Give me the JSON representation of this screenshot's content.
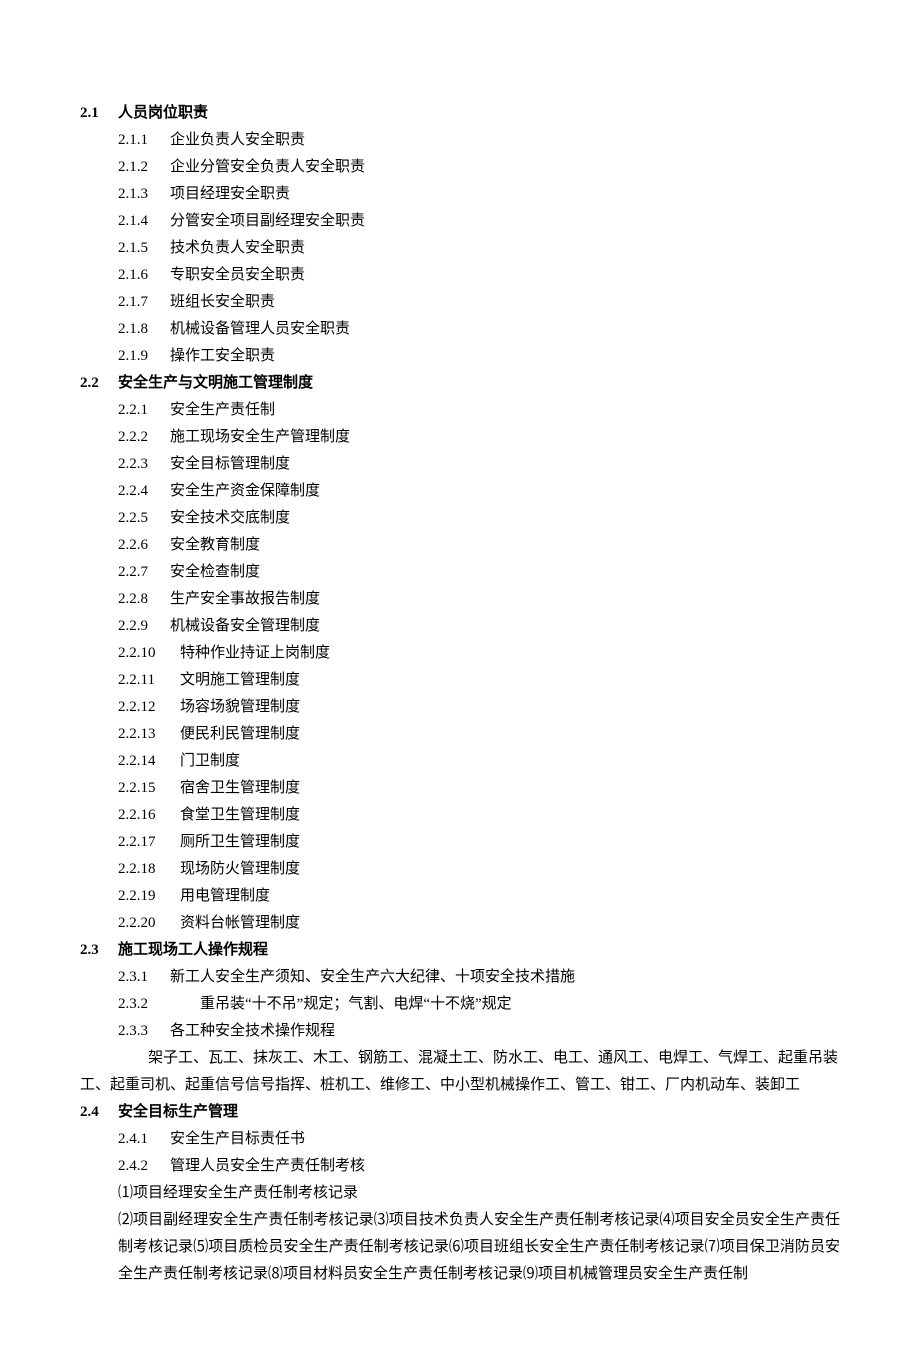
{
  "sections": {
    "s2_1": {
      "number": "2.1",
      "title": "人员岗位职责",
      "items": [
        {
          "num": "2.1.1",
          "text": "企业负责人安全职责"
        },
        {
          "num": "2.1.2",
          "text": "企业分管安全负责人安全职责"
        },
        {
          "num": "2.1.3",
          "text": "项目经理安全职责"
        },
        {
          "num": "2.1.4",
          "text": "分管安全项目副经理安全职责"
        },
        {
          "num": "2.1.5",
          "text": "技术负责人安全职责"
        },
        {
          "num": "2.1.6",
          "text": "专职安全员安全职责"
        },
        {
          "num": "2.1.7",
          "text": "班组长安全职责"
        },
        {
          "num": "2.1.8",
          "text": "机械设备管理人员安全职责"
        },
        {
          "num": "2.1.9",
          "text": "操作工安全职责"
        }
      ]
    },
    "s2_2": {
      "number": "2.2",
      "title": "安全生产与文明施工管理制度",
      "items": [
        {
          "num": "2.2.1",
          "text": "安全生产责任制"
        },
        {
          "num": "2.2.2",
          "text": "施工现场安全生产管理制度"
        },
        {
          "num": "2.2.3",
          "text": "安全目标管理制度"
        },
        {
          "num": "2.2.4",
          "text": "安全生产资金保障制度"
        },
        {
          "num": "2.2.5",
          "text": "安全技术交底制度"
        },
        {
          "num": "2.2.6",
          "text": "安全教育制度"
        },
        {
          "num": "2.2.7",
          "text": "安全检查制度"
        },
        {
          "num": "2.2.8",
          "text": "生产安全事故报告制度"
        },
        {
          "num": "2.2.9",
          "text": "机械设备安全管理制度"
        },
        {
          "num": "2.2.10",
          "text": "特种作业持证上岗制度"
        },
        {
          "num": "2.2.11",
          "text": "文明施工管理制度"
        },
        {
          "num": "2.2.12",
          "text": "场容场貌管理制度"
        },
        {
          "num": "2.2.13",
          "text": "便民利民管理制度"
        },
        {
          "num": "2.2.14",
          "text": "门卫制度"
        },
        {
          "num": "2.2.15",
          "text": "宿舍卫生管理制度"
        },
        {
          "num": "2.2.16",
          "text": "食堂卫生管理制度"
        },
        {
          "num": "2.2.17",
          "text": "厕所卫生管理制度"
        },
        {
          "num": "2.2.18",
          "text": "现场防火管理制度"
        },
        {
          "num": "2.2.19",
          "text": "用电管理制度"
        },
        {
          "num": "2.2.20",
          "text": "资料台帐管理制度"
        }
      ]
    },
    "s2_3": {
      "number": "2.3",
      "title": "施工现场工人操作规程",
      "items": [
        {
          "num": "2.3.1",
          "text": "新工人安全生产须知、安全生产六大纪律、十项安全技术措施"
        },
        {
          "num": "2.3.2",
          "text": "　　重吊装“十不吊”规定；气割、电焊“十不烧”规定"
        },
        {
          "num": "2.3.3",
          "text": "各工种安全技术操作规程"
        }
      ],
      "trailing1": "　　架子工、瓦工、抹灰工、木工、钢筋工、混凝土工、防水工、电工、通风工、电焊工、气焊工、起重吊装",
      "trailing2": "工、起重司机、起重信号信号指挥、桩机工、维修工、中小型机械操作工、管工、钳工、厂内机动车、装卸工"
    },
    "s2_4": {
      "number": "2.4",
      "title": "安全目标生产管理",
      "items": [
        {
          "num": "2.4.1",
          "text": "安全生产目标责任书"
        },
        {
          "num": "2.4.2",
          "text": "管理人员安全生产责任制考核"
        }
      ],
      "sub1": "⑴项目经理安全生产责任制考核记录",
      "sub2": "⑵项目副经理安全生产责任制考核记录⑶项目技术负责人安全生产责任制考核记录⑷项目安全员安全生产责任制考核记录⑸项目质检员安全生产责任制考核记录⑹项目班组长安全生产责任制考核记录⑺项目保卫消防员安全生产责任制考核记录⑻项目材料员安全生产责任制考核记录⑼项目机械管理员安全生产责任制"
    }
  }
}
